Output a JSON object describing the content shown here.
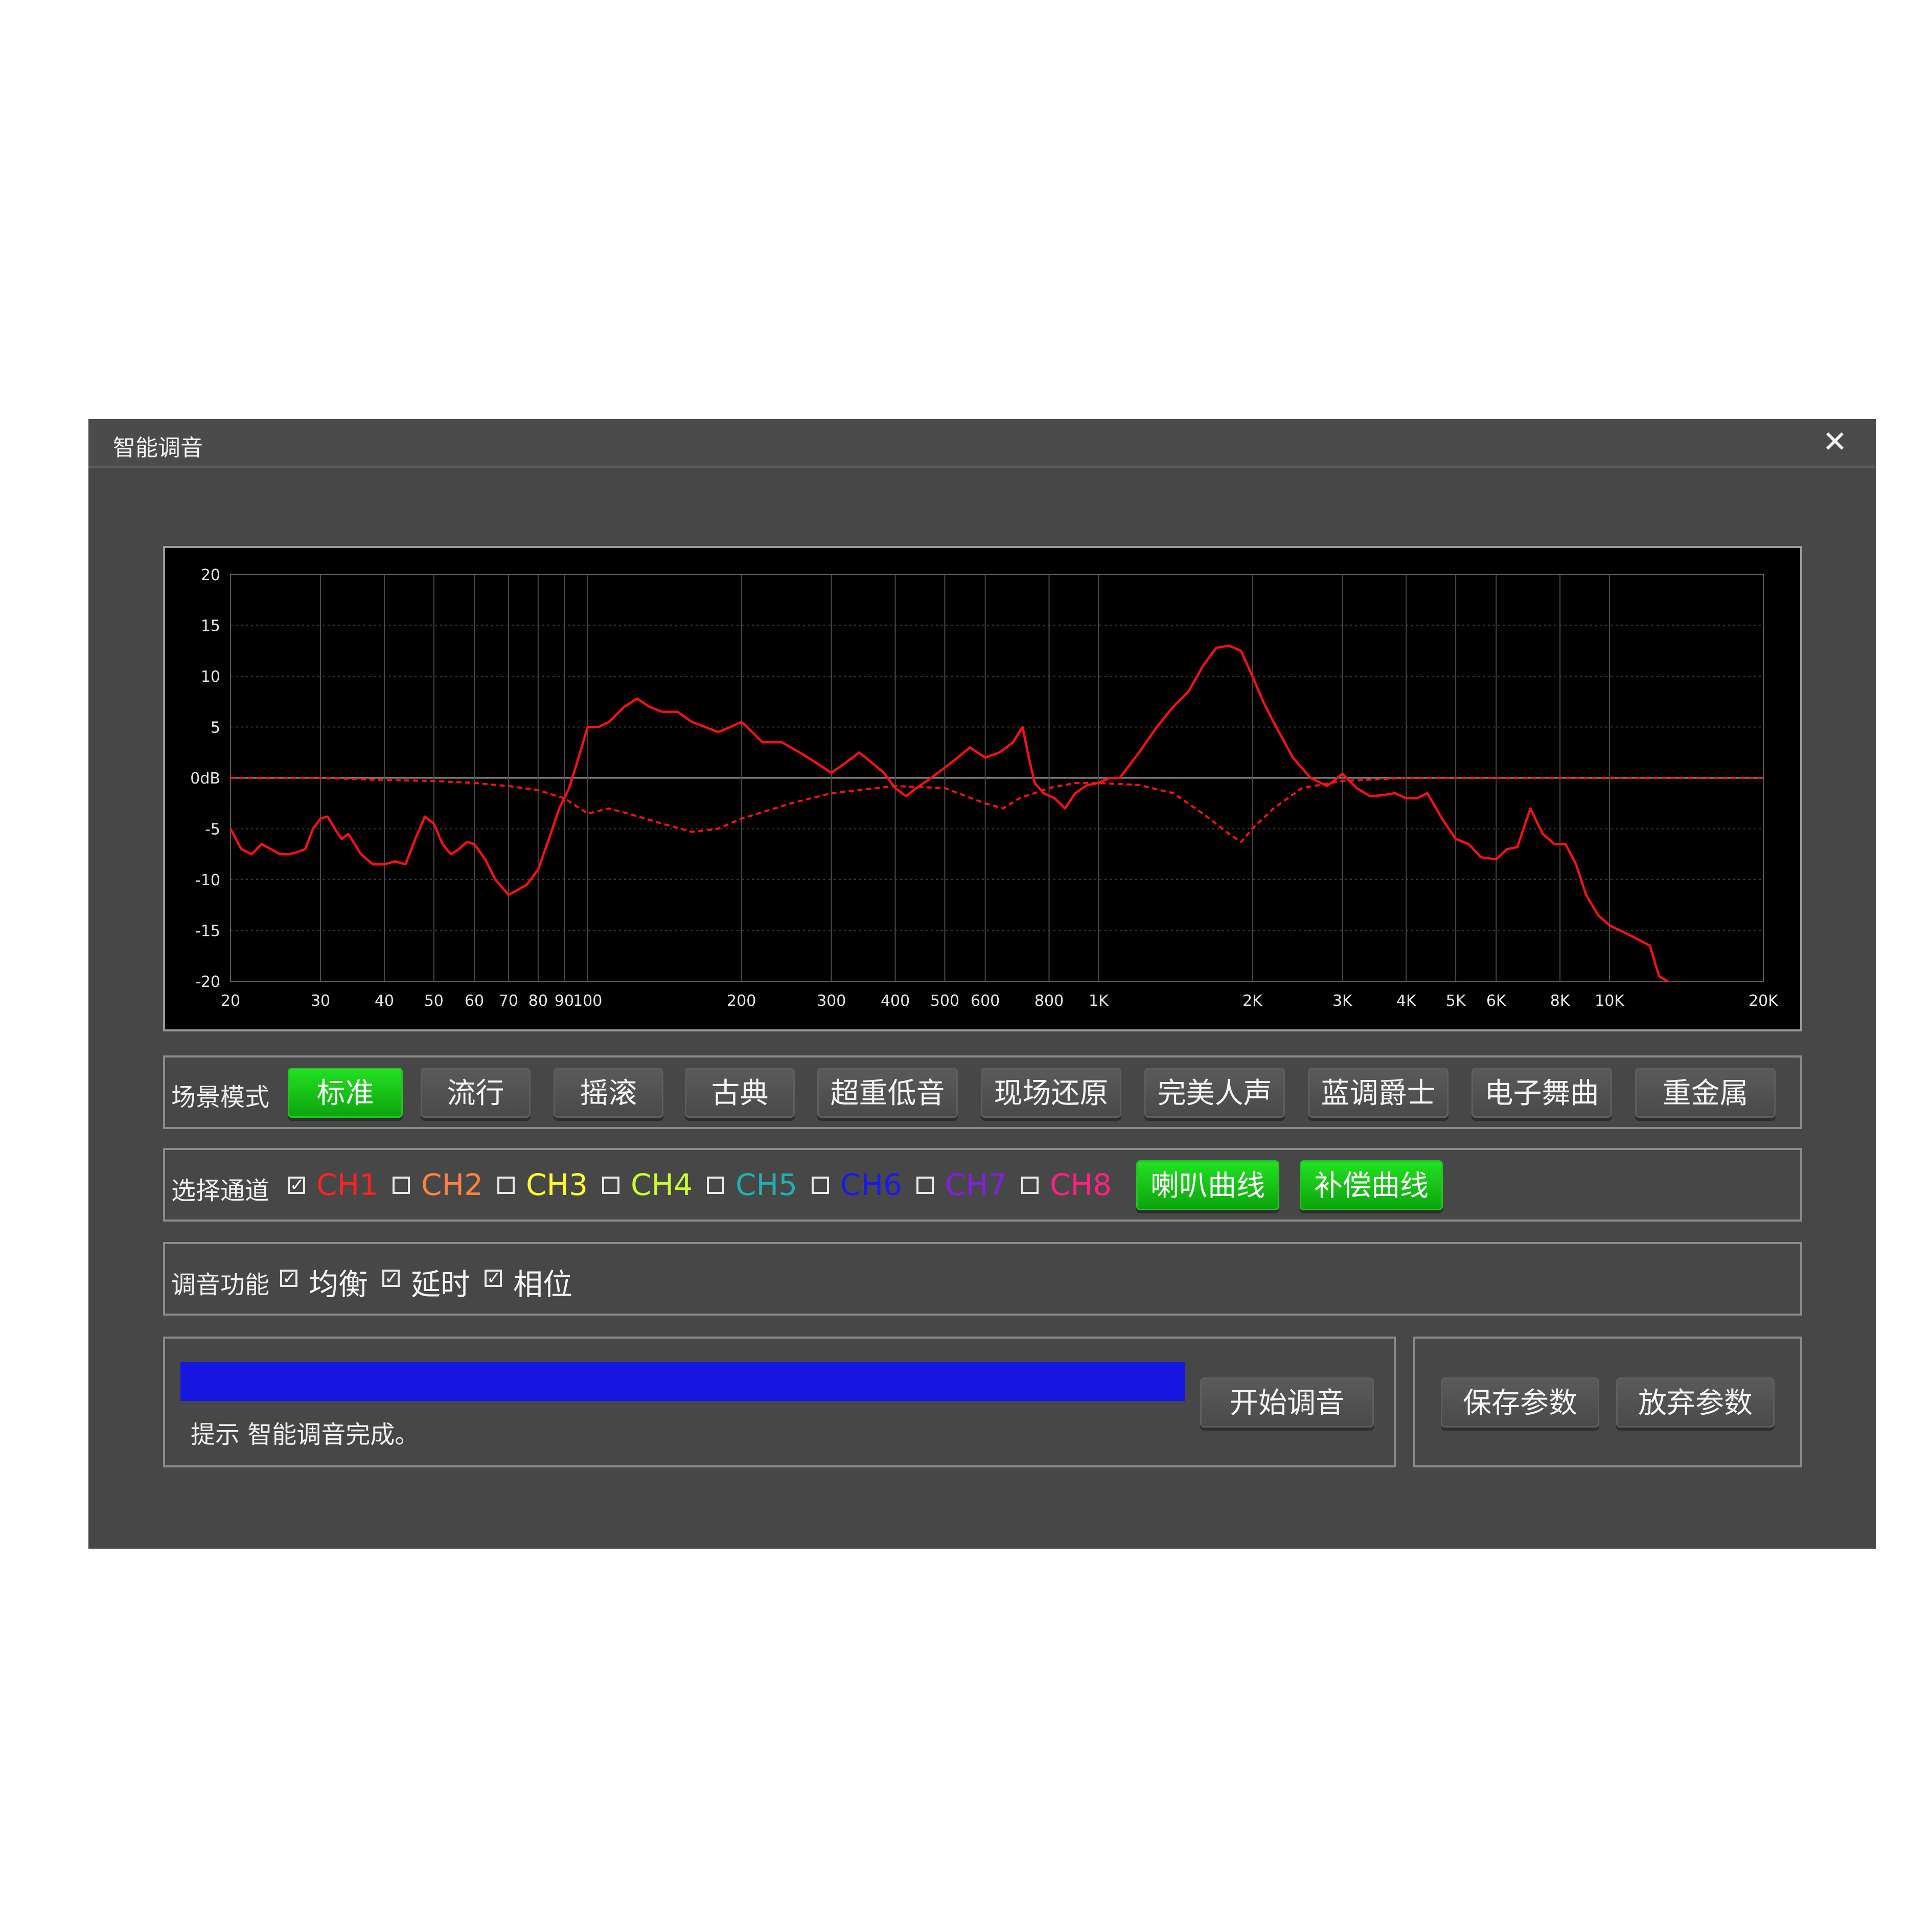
{
  "dialog": {
    "title": "智能调音",
    "close_icon": "close-icon"
  },
  "chart_data": {
    "type": "line",
    "x_scale": "log",
    "xlim": [
      20,
      20000
    ],
    "ylim": [
      -20,
      20
    ],
    "y_ticks": [
      20,
      15,
      10,
      5,
      0,
      -5,
      -10,
      -15,
      -20
    ],
    "y_tick_labels": [
      "20",
      "15",
      "10",
      "5",
      "0dB",
      "-5",
      "-10",
      "-15",
      "-20"
    ],
    "x_ticks": [
      20,
      30,
      40,
      50,
      60,
      70,
      80,
      90,
      100,
      200,
      300,
      400,
      500,
      600,
      800,
      1000,
      2000,
      3000,
      4000,
      5000,
      6000,
      8000,
      10000,
      20000
    ],
    "x_tick_labels": [
      "20",
      "30",
      "40",
      "50",
      "60",
      "70",
      "80",
      "90",
      "100",
      "200",
      "300",
      "400",
      "500",
      "600",
      "800",
      "1K",
      "2K",
      "3K",
      "4K",
      "5K",
      "6K",
      "8K",
      "10K",
      "20K"
    ],
    "grid": true,
    "series": [
      {
        "style": "solid",
        "color": "#ff1010",
        "x": [
          20,
          21,
          22,
          23,
          24,
          25,
          26,
          27,
          28,
          29,
          30,
          31,
          32,
          33,
          34,
          35,
          36,
          38,
          40,
          42,
          44,
          46,
          48,
          50,
          52,
          54,
          56,
          58,
          60,
          63,
          66,
          70,
          73,
          76,
          80,
          84,
          88,
          92,
          96,
          100,
          105,
          110,
          118,
          125,
          132,
          140,
          150,
          160,
          170,
          180,
          190,
          200,
          210,
          220,
          240,
          260,
          280,
          300,
          320,
          340,
          360,
          380,
          400,
          420,
          440,
          470,
          500,
          530,
          560,
          600,
          640,
          680,
          710,
          730,
          750,
          780,
          820,
          860,
          900,
          950,
          1000,
          1050,
          1100,
          1200,
          1300,
          1400,
          1500,
          1600,
          1700,
          1800,
          1900,
          2000,
          2100,
          2200,
          2400,
          2600,
          2800,
          3000,
          3200,
          3400,
          3600,
          3800,
          4000,
          4200,
          4400,
          4700,
          5000,
          5300,
          5600,
          6000,
          6300,
          6600,
          7000,
          7400,
          7800,
          8200,
          8600,
          9000,
          9500,
          10000,
          11000,
          12000,
          12500,
          13000
        ],
        "y": [
          -5,
          -7,
          -7.5,
          -6.5,
          -7,
          -7.5,
          -7.5,
          -7.3,
          -7,
          -5,
          -4,
          -3.8,
          -5,
          -6,
          -5.5,
          -6.5,
          -7.5,
          -8.5,
          -8.5,
          -8.2,
          -8.5,
          -6,
          -3.8,
          -4.5,
          -6.5,
          -7.5,
          -7,
          -6.3,
          -6.5,
          -8,
          -10,
          -11.5,
          -11,
          -10.5,
          -9,
          -6,
          -3,
          -1,
          2,
          5,
          5,
          5.5,
          7,
          7.8,
          7,
          6.5,
          6.5,
          5.5,
          5,
          4.5,
          5,
          5.5,
          4.5,
          3.5,
          3.5,
          2.5,
          1.5,
          0.5,
          1.5,
          2.5,
          1.5,
          0.5,
          -1,
          -1.8,
          -1,
          0,
          1,
          2,
          3,
          2,
          2.5,
          3.5,
          5,
          2,
          -0.5,
          -1.5,
          -2,
          -3,
          -1.5,
          -0.7,
          -0.5,
          0,
          0,
          2.5,
          5,
          7,
          8.5,
          11,
          12.8,
          13,
          12.5,
          10,
          7.5,
          5.5,
          2,
          0,
          -0.8,
          0.4,
          -1,
          -1.8,
          -1.7,
          -1.5,
          -2,
          -2,
          -1.5,
          -4,
          -6,
          -6.5,
          -7.8,
          -8,
          -7,
          -6.8,
          -3,
          -5.5,
          -6.5,
          -6.5,
          -8.5,
          -11.5,
          -13.5,
          -14.5,
          -15.5,
          -16.5,
          -19.5,
          -20
        ]
      },
      {
        "style": "dashed",
        "color": "#ff1010",
        "x": [
          20,
          30,
          40,
          50,
          60,
          70,
          80,
          90,
          100,
          110,
          120,
          140,
          160,
          180,
          200,
          250,
          300,
          400,
          500,
          600,
          650,
          700,
          800,
          900,
          1000,
          1200,
          1400,
          1600,
          1800,
          1900,
          2000,
          2200,
          2500,
          3000,
          4000,
          5000,
          10000,
          20000
        ],
        "y": [
          0,
          0,
          -0.2,
          -0.3,
          -0.5,
          -0.8,
          -1.2,
          -2,
          -3.5,
          -3,
          -3.5,
          -4.5,
          -5.3,
          -5,
          -4,
          -2.5,
          -1.5,
          -0.8,
          -1,
          -2.5,
          -3,
          -2,
          -1,
          -0.5,
          -0.5,
          -0.7,
          -1.5,
          -3.5,
          -5.5,
          -6.3,
          -5,
          -3,
          -1,
          -0.3,
          0,
          0,
          0,
          0
        ]
      }
    ]
  },
  "scene": {
    "label": "场景模式",
    "buttons": [
      "标准",
      "流行",
      "摇滚",
      "古典",
      "超重低音",
      "现场还原",
      "完美人声",
      "蓝调爵士",
      "电子舞曲",
      "重金属"
    ],
    "active_index": 0,
    "active_color": "#1ad21a"
  },
  "channel": {
    "label": "选择通道",
    "check_mark": "☑",
    "items": [
      {
        "label": "CH1",
        "checked": true,
        "color": "#ff2222"
      },
      {
        "label": "CH2",
        "checked": false,
        "color": "#ff8040"
      },
      {
        "label": "CH3",
        "checked": false,
        "color": "#ffff30"
      },
      {
        "label": "CH4",
        "checked": false,
        "color": "#c8ff30"
      },
      {
        "label": "CH5",
        "checked": false,
        "color": "#20b0b0"
      },
      {
        "label": "CH6",
        "checked": false,
        "color": "#1a1ae8"
      },
      {
        "label": "CH7",
        "checked": false,
        "color": "#8020e0"
      },
      {
        "label": "CH8",
        "checked": false,
        "color": "#ff2080"
      }
    ],
    "speaker_curve": "喇叭曲线",
    "comp_curve": "补偿曲线"
  },
  "tuning": {
    "label": "调音功能",
    "items": [
      {
        "label": "均衡",
        "checked": true
      },
      {
        "label": "延时",
        "checked": true
      },
      {
        "label": "相位",
        "checked": true
      }
    ]
  },
  "progress": {
    "value": 1.0,
    "color": "#1616e0",
    "hint": "提示 智能调音完成。",
    "start_button": "开始调音"
  },
  "actions": {
    "save": "保存参数",
    "discard": "放弃参数"
  }
}
